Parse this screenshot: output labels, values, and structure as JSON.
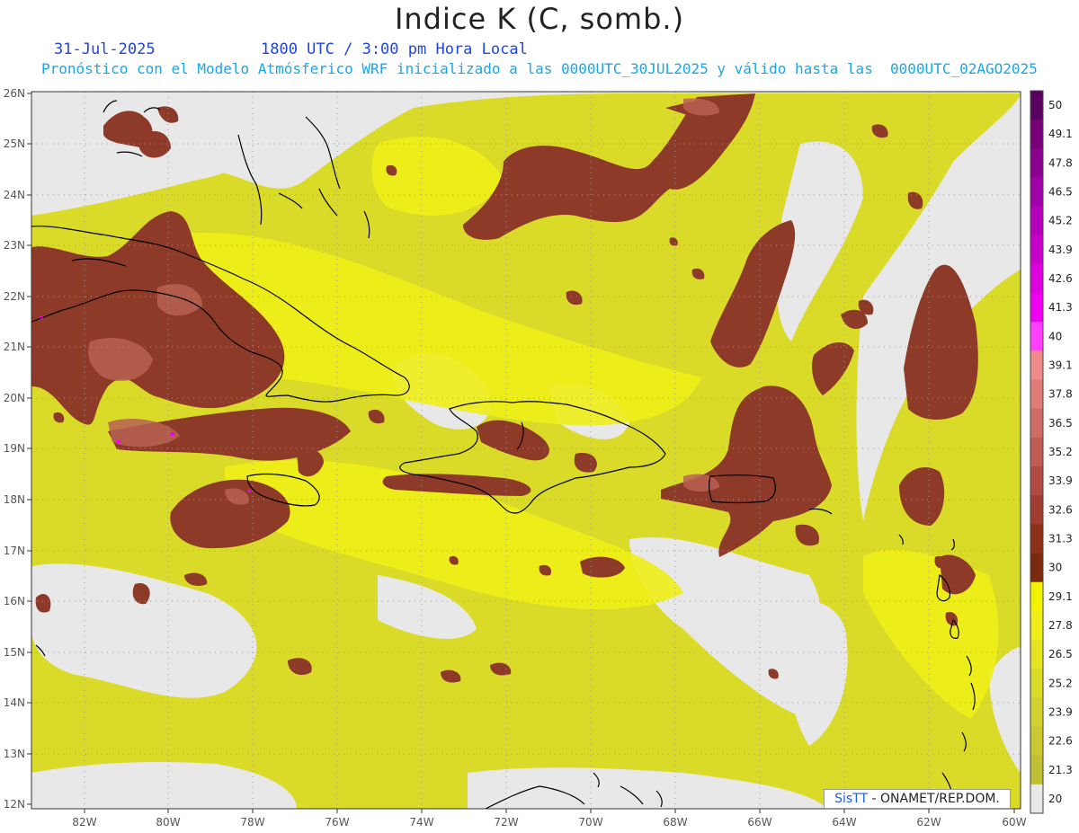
{
  "header": {
    "title": "Indice K (C, somb.)",
    "date": "31-Jul-2025",
    "time": "1800 UTC / 3:00 pm Hora Local",
    "description": "Pronóstico con el Modelo Atmósferico WRF inicializado a las 0000UTC_30JUL2025 y válido hasta las  0000UTC_02AGO2025"
  },
  "axes": {
    "lon_ticks": [
      "82W",
      "80W",
      "78W",
      "76W",
      "74W",
      "72W",
      "70W",
      "68W",
      "66W",
      "64W",
      "62W",
      "60W"
    ],
    "lat_ticks": [
      "26N",
      "25N",
      "24N",
      "23N",
      "22N",
      "21N",
      "20N",
      "19N",
      "18N",
      "17N",
      "16N",
      "15N",
      "14N",
      "13N",
      "12N"
    ]
  },
  "colorbar": {
    "labels": [
      "50",
      "49.1",
      "47.8",
      "46.5",
      "45.2",
      "43.9",
      "42.6",
      "41.3",
      "40",
      "39.1",
      "37.8",
      "36.5",
      "35.2",
      "33.9",
      "32.6",
      "31.3",
      "30",
      "29.1",
      "27.8",
      "26.5",
      "25.2",
      "23.9",
      "22.6",
      "21.3",
      "20"
    ],
    "colors": [
      "#5a0060",
      "#780078",
      "#8c0090",
      "#a000a8",
      "#b400bc",
      "#c800cc",
      "#dc00dc",
      "#f000f0",
      "#ff40ff",
      "#f08a8a",
      "#e07c78",
      "#d06c66",
      "#c05c54",
      "#b04a42",
      "#a03c30",
      "#8c3018",
      "#7a2a0e",
      "#f2f200",
      "#eeee18",
      "#e4e420",
      "#dada28",
      "#d0d030",
      "#c8c832",
      "#c0c034",
      "#e8e8e8"
    ]
  },
  "credit": {
    "brand": "SisTT",
    "org": " - ONAMET/REP.DOM."
  },
  "colors": {
    "background": "#e8e8e8",
    "low": "#c8c832",
    "mid": "#eaea16",
    "high": "#ffff00",
    "brown": "#8e3a28",
    "brown_light": "#b05a48",
    "coast": "#000000"
  }
}
